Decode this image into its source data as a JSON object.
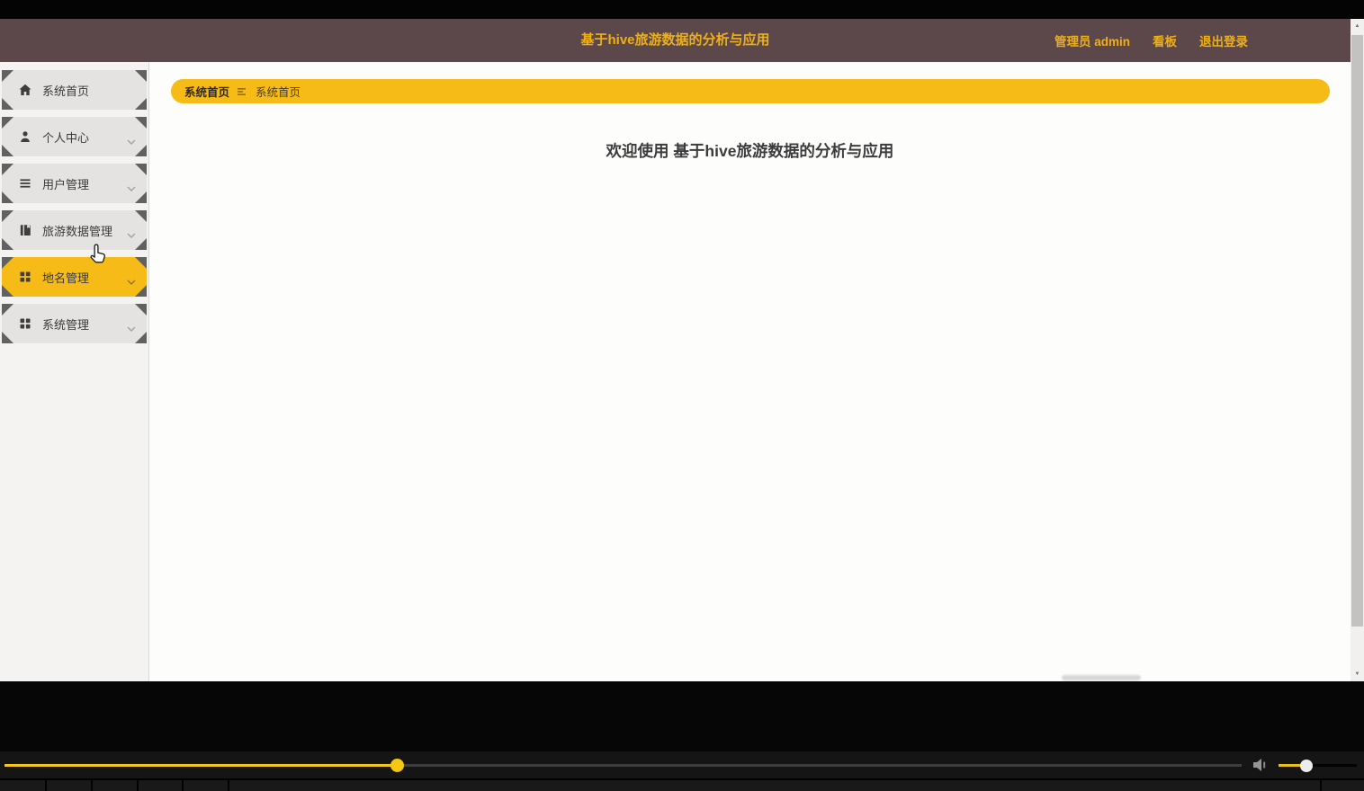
{
  "header": {
    "title": "基于hive旅游数据的分析与应用",
    "user_label": "管理员 admin",
    "dashboard_label": "看板",
    "logout_label": "退出登录"
  },
  "sidebar": {
    "items": [
      {
        "label": "系统首页",
        "icon": "home-icon",
        "active": false,
        "has_submenu": false
      },
      {
        "label": "个人中心",
        "icon": "user-icon",
        "active": false,
        "has_submenu": true
      },
      {
        "label": "用户管理",
        "icon": "list-icon",
        "active": false,
        "has_submenu": true
      },
      {
        "label": "旅游数据管理",
        "icon": "book-icon",
        "active": false,
        "has_submenu": true
      },
      {
        "label": "地名管理",
        "icon": "grid-icon",
        "active": true,
        "has_submenu": true
      },
      {
        "label": "系统管理",
        "icon": "grid-icon",
        "active": false,
        "has_submenu": true
      }
    ]
  },
  "breadcrumb": {
    "root": "系统首页",
    "separator_icon": "lines-separator-icon",
    "current": "系统首页"
  },
  "main": {
    "welcome_title": "欢迎使用 基于hive旅游数据的分析与应用"
  },
  "video_player": {
    "progress_percent": 31.7,
    "volume_percent": 36,
    "volume_icon": "speaker-icon"
  },
  "colors": {
    "accent_yellow": "#f6bb16",
    "header_maroon": "#5c484b",
    "player_yellow": "#f3c713"
  }
}
